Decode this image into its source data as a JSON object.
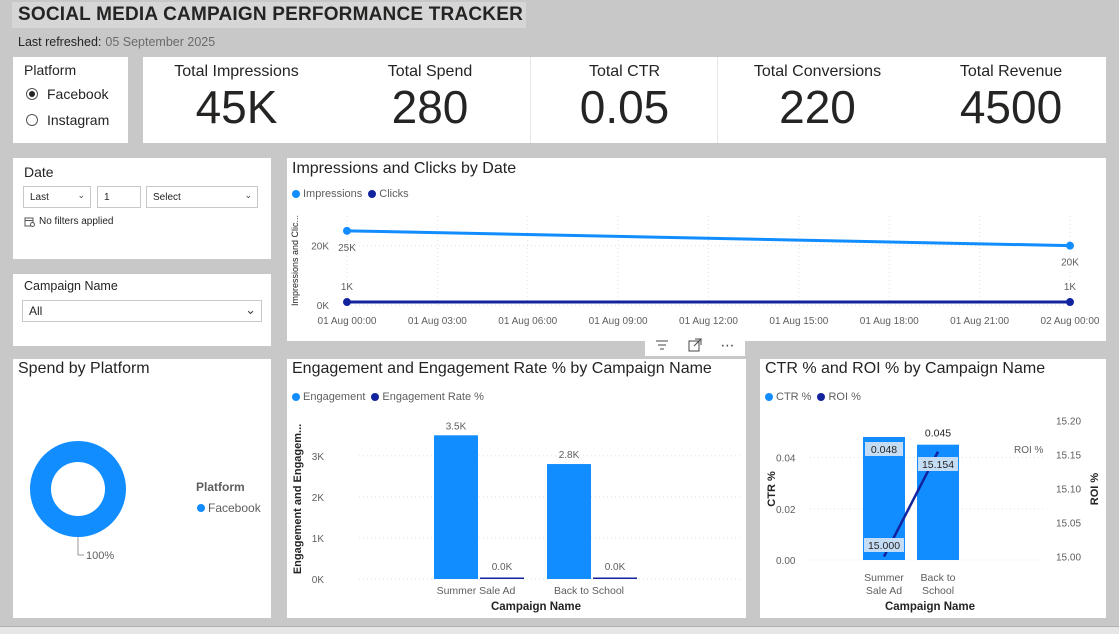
{
  "header": {
    "title": "SOCIAL MEDIA CAMPAIGN PERFORMANCE TRACKER",
    "refresh_label": "Last refreshed:",
    "refresh_date": "05 September 2025"
  },
  "platform_slicer": {
    "title": "Platform",
    "options": [
      {
        "label": "Facebook",
        "selected": true
      },
      {
        "label": "Instagram",
        "selected": false
      }
    ]
  },
  "kpis": [
    {
      "label": "Total Impressions",
      "value": "45K"
    },
    {
      "label": "Total Spend",
      "value": "280"
    },
    {
      "label": "Total CTR",
      "value": "0.05"
    },
    {
      "label": "Total Conversions",
      "value": "220"
    },
    {
      "label": "Total Revenue",
      "value": "4500"
    }
  ],
  "date_slicer": {
    "title": "Date",
    "relative": "Last",
    "count": "1",
    "unit_placeholder": "Select",
    "status": "No filters applied"
  },
  "campaign_slicer": {
    "title": "Campaign Name",
    "value": "All"
  },
  "visual_header_icons": [
    "filter-icon",
    "focus-mode-icon",
    "more-options-icon"
  ],
  "colors": {
    "primary": "#118dff",
    "secondary": "#12239e",
    "background": "#c8c8c8",
    "card": "#ffffff"
  },
  "chart_data": [
    {
      "id": "impressions-clicks",
      "type": "line",
      "title": "Impressions and Clicks by Date",
      "ylabel": "Impressions and Clic...",
      "xlabel": "",
      "x": [
        "01 Aug 00:00",
        "01 Aug 03:00",
        "01 Aug 06:00",
        "01 Aug 09:00",
        "01 Aug 12:00",
        "01 Aug 15:00",
        "01 Aug 18:00",
        "01 Aug 21:00",
        "02 Aug 00:00"
      ],
      "yticks": [
        "0K",
        "20K"
      ],
      "ylim": [
        0,
        30000
      ],
      "grid": true,
      "legend": "top-left",
      "series": [
        {
          "name": "Impressions",
          "color": "#118dff",
          "points": [
            {
              "x": "01 Aug 00:00",
              "y": 25000,
              "label": "25K"
            },
            {
              "x": "02 Aug 00:00",
              "y": 20000,
              "label": "20K"
            }
          ]
        },
        {
          "name": "Clicks",
          "color": "#12239e",
          "points": [
            {
              "x": "01 Aug 00:00",
              "y": 1000,
              "label": "1K"
            },
            {
              "x": "02 Aug 00:00",
              "y": 1000,
              "label": "1K"
            }
          ]
        }
      ]
    },
    {
      "id": "spend-platform",
      "type": "pie",
      "title": "Spend by Platform",
      "legend_title": "Platform",
      "legend": "right",
      "slices": [
        {
          "name": "Facebook",
          "value": 100,
          "label": "100%",
          "color": "#118dff"
        }
      ]
    },
    {
      "id": "engagement",
      "type": "bar",
      "title": "Engagement and Engagement Rate % by Campaign Name",
      "xlabel": "Campaign Name",
      "ylabel": "Engagement and Engagem...",
      "categories": [
        "Summer Sale Ad",
        "Back to School"
      ],
      "yticks": [
        "0K",
        "1K",
        "2K",
        "3K"
      ],
      "ylim": [
        0,
        3800
      ],
      "grid": true,
      "legend": "top-left",
      "series": [
        {
          "name": "Engagement",
          "color": "#118dff",
          "values": [
            3500,
            2800
          ],
          "labels": [
            "3.5K",
            "2.8K"
          ]
        },
        {
          "name": "Engagement Rate %",
          "color": "#12239e",
          "values": [
            0,
            0
          ],
          "labels": [
            "0.0K",
            "0.0K"
          ]
        }
      ]
    },
    {
      "id": "ctr-roi",
      "type": "bar",
      "title": "CTR % and ROI % by Campaign Name",
      "xlabel": "Campaign Name",
      "ylabel": "CTR %",
      "y2label": "ROI %",
      "y2label_inline": "ROI %",
      "categories": [
        "Summer Sale Ad",
        "Back to School"
      ],
      "category_lines": [
        [
          "Summer",
          "Sale Ad"
        ],
        [
          "Back to",
          "School"
        ]
      ],
      "ylim": [
        0,
        0.048
      ],
      "yticks": [
        "0.00",
        "0.02",
        "0.04"
      ],
      "y2lim": [
        14.995,
        15.205
      ],
      "y2ticks": [
        "15.00",
        "15.05",
        "15.10",
        "15.15",
        "15.20"
      ],
      "grid": true,
      "legend": "top-left",
      "series": [
        {
          "name": "CTR %",
          "color": "#118dff",
          "kind": "bar",
          "axis": "left",
          "values": [
            0.048,
            0.045
          ],
          "labels": [
            "0.048",
            "0.045"
          ]
        },
        {
          "name": "ROI %",
          "color": "#12239e",
          "kind": "line",
          "axis": "right",
          "values": [
            15.0,
            15.154
          ],
          "labels": [
            "15.000",
            "15.154"
          ]
        }
      ]
    }
  ]
}
